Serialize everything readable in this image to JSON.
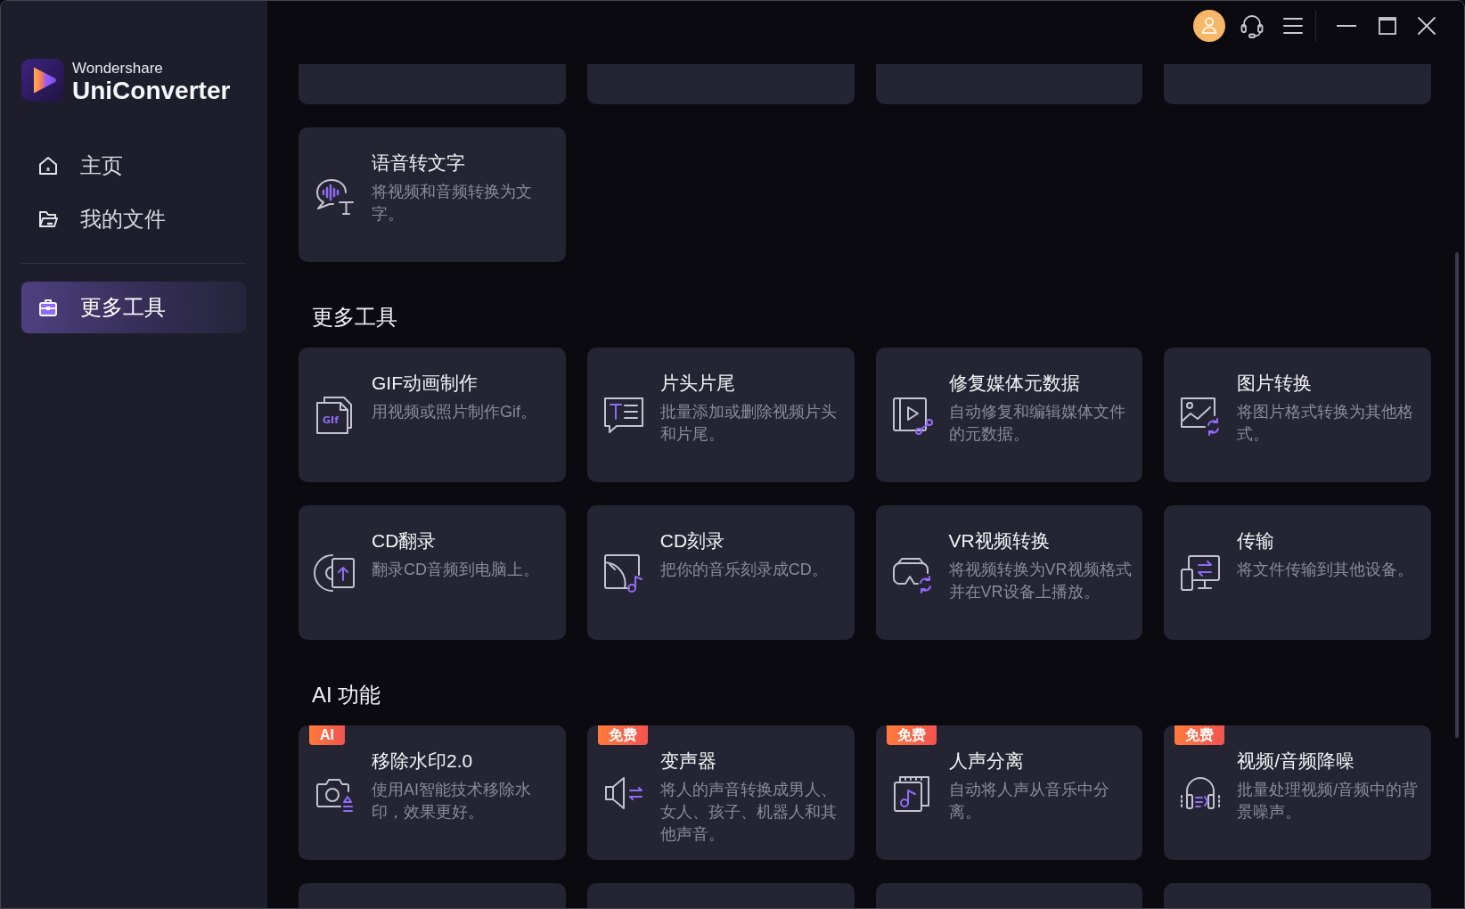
{
  "sidebar": {
    "logo": {
      "brand": "Wondershare",
      "product": "UniConverter"
    },
    "groups": [
      {
        "items": [
          {
            "label": "主页",
            "selected": false
          },
          {
            "label": "我的文件",
            "selected": false
          }
        ]
      },
      {
        "items": [
          {
            "label": "更多工具",
            "selected": true
          }
        ]
      }
    ]
  },
  "sections": [
    {
      "cards": [
        {
          "kind": "clipped"
        },
        {
          "kind": "clipped"
        },
        {
          "kind": "clipped"
        },
        {
          "kind": "clipped"
        },
        {
          "kind": "tool",
          "title": "语音转文字",
          "description": "将视频和音频转换为文字。"
        }
      ]
    },
    {
      "heading": "更多工具",
      "cards": [
        {
          "kind": "tool",
          "title": "GIF动画制作",
          "description": "用视频或照片制作Gif。",
          "icon_label": "GIf"
        },
        {
          "kind": "tool",
          "title": "片头片尾",
          "description": "批量添加或删除视频片头和片尾。"
        },
        {
          "kind": "tool",
          "title": "修复媒体元数据",
          "description": "自动修复和编辑媒体文件的元数据。"
        },
        {
          "kind": "tool",
          "title": "图片转换",
          "description": "将图片格式转换为其他格式。"
        },
        {
          "kind": "tool",
          "title": "CD翻录",
          "description": "翻录CD音频到电脑上。"
        },
        {
          "kind": "tool",
          "title": "CD刻录",
          "description": "把你的音乐刻录成CD。"
        },
        {
          "kind": "tool",
          "title": "VR视频转换",
          "description": "将视频转换为VR视频格式并在VR设备上播放。"
        },
        {
          "kind": "tool",
          "title": "传输",
          "description": "将文件传输到其他设备。"
        }
      ]
    },
    {
      "heading": "AI 功能",
      "cards": [
        {
          "kind": "tool",
          "badge": "AI",
          "title": "移除水印2.0",
          "description": "使用AI智能技术移除水印，效果更好。"
        },
        {
          "kind": "tool",
          "badge": "免费",
          "title": "变声器",
          "description": "将人的声音转换成男人、女人、孩子、机器人和其他声音。"
        },
        {
          "kind": "tool",
          "badge": "免费",
          "title": "人声分离",
          "description": "自动将人声从音乐中分离。"
        },
        {
          "kind": "tool",
          "badge": "免费",
          "title": "视频/音频降噪",
          "description": "批量处理视频/音频中的背景噪声。"
        },
        {
          "kind": "clipped"
        },
        {
          "kind": "clipped"
        },
        {
          "kind": "clipped"
        },
        {
          "kind": "clipped"
        }
      ]
    }
  ]
}
